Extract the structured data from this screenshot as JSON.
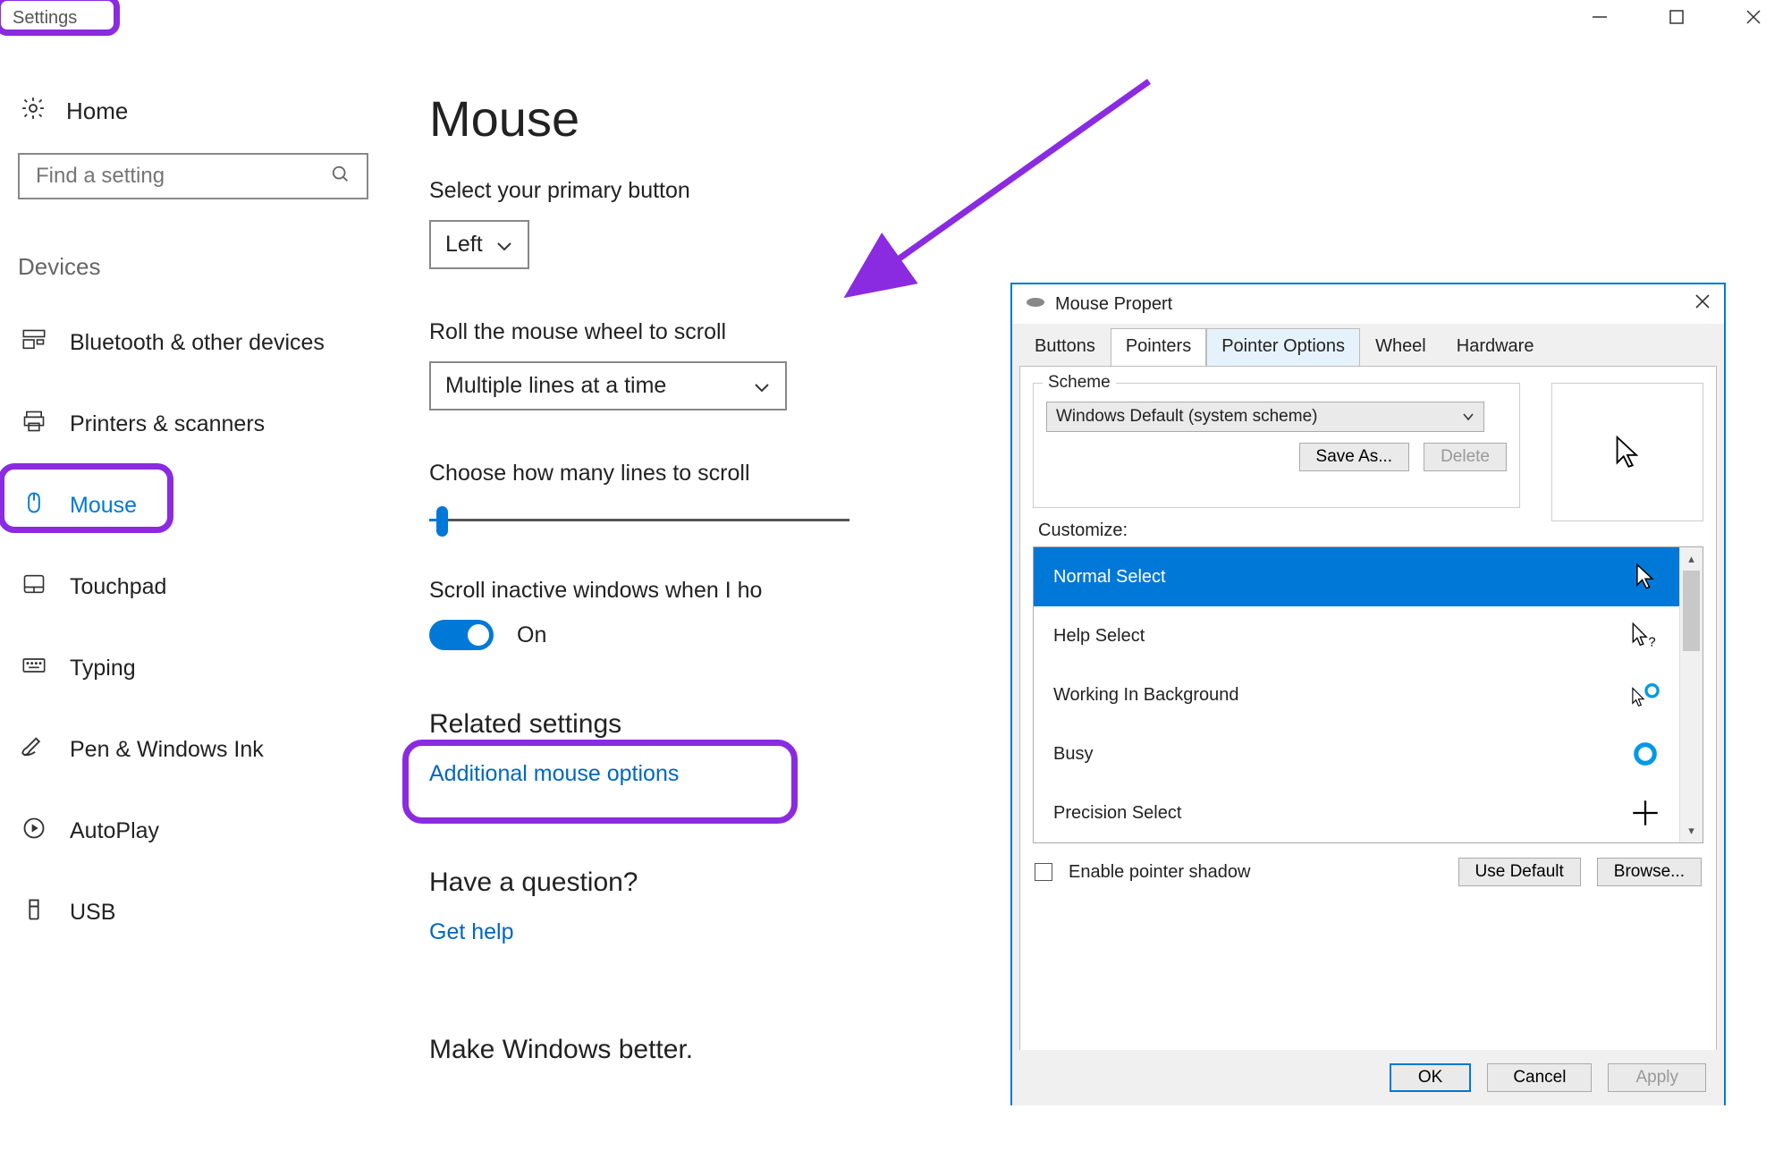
{
  "window": {
    "title": "Settings"
  },
  "nav": {
    "home": "Home",
    "search_placeholder": "Find a setting",
    "section": "Devices",
    "items": [
      {
        "label": "Bluetooth & other devices"
      },
      {
        "label": "Printers & scanners"
      },
      {
        "label": "Mouse"
      },
      {
        "label": "Touchpad"
      },
      {
        "label": "Typing"
      },
      {
        "label": "Pen & Windows Ink"
      },
      {
        "label": "AutoPlay"
      },
      {
        "label": "USB"
      }
    ]
  },
  "main": {
    "title": "Mouse",
    "primary_btn_label": "Select your primary button",
    "primary_btn_value": "Left",
    "wheel_label": "Roll the mouse wheel to scroll",
    "wheel_value": "Multiple lines at a time",
    "lines_label": "Choose how many lines to scroll",
    "inactive_label": "Scroll inactive windows when I ho",
    "inactive_state": "On",
    "related_heading": "Related settings",
    "additional_link": "Additional mouse options",
    "question_heading": "Have a question?",
    "gethelp_link": "Get help",
    "better_heading": "Make Windows better."
  },
  "dialog": {
    "title": "Mouse Propert",
    "tabs": [
      "Buttons",
      "Pointers",
      "Pointer Options",
      "Wheel",
      "Hardware"
    ],
    "scheme_title": "Scheme",
    "scheme_value": "Windows Default (system scheme)",
    "saveas": "Save As...",
    "delete": "Delete",
    "customize_label": "Customize:",
    "cursors": [
      "Normal Select",
      "Help Select",
      "Working In Background",
      "Busy",
      "Precision Select"
    ],
    "enable_shadow": "Enable pointer shadow",
    "use_default": "Use Default",
    "browse": "Browse...",
    "ok": "OK",
    "cancel": "Cancel",
    "apply": "Apply"
  }
}
